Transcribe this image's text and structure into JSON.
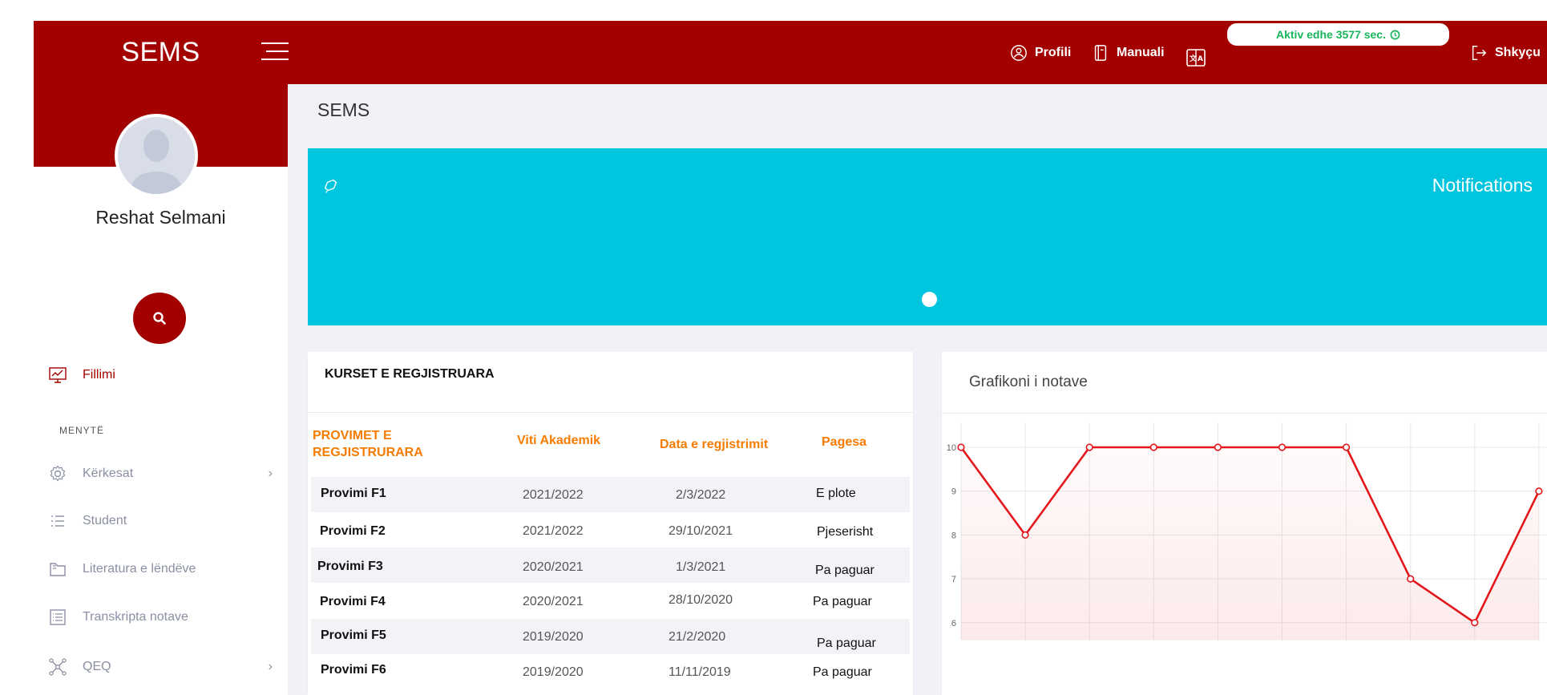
{
  "app": {
    "brand": "SEMS"
  },
  "topbar": {
    "profile_label": "Profili",
    "manual_label": "Manuali",
    "timer_text": "Aktiv edhe 3577 sec.",
    "logout_label": "Shkyçu",
    "colors": {
      "bar": "#a30000",
      "timer_text": "#17b65a"
    }
  },
  "sidebar": {
    "username": "Reshat Selmani",
    "home_label": "Fillimi",
    "section_label": "MENYTË",
    "items": [
      {
        "label": "Kërkesat",
        "icon": "gear-icon",
        "has_submenu": true
      },
      {
        "label": "Student",
        "icon": "list-icon",
        "has_submenu": false
      },
      {
        "label": "Literatura e lëndëve",
        "icon": "book-icon",
        "has_submenu": false
      },
      {
        "label": "Transkripta notave",
        "icon": "document-list-icon",
        "has_submenu": false
      },
      {
        "label": "QEQ",
        "icon": "network-icon",
        "has_submenu": true
      }
    ]
  },
  "main": {
    "page_title": "SEMS",
    "notifications": {
      "title": "Notifications",
      "color": "#00c5df"
    },
    "courses": {
      "title": "KURSET E REGJISTRUARA",
      "headers": {
        "exam_line1": "PROVIMET E",
        "exam_line2": "REGJISTRURARA",
        "year": "Viti Akademik",
        "date": "Data e regjistrimit",
        "payment": "Pagesa"
      },
      "rows": [
        {
          "exam": "Provimi F1",
          "year": "2021/2022",
          "date": "2/3/2022",
          "payment": "E plote"
        },
        {
          "exam": "Provimi F2",
          "year": "2021/2022",
          "date": "29/10/2021",
          "payment": "Pjeserisht"
        },
        {
          "exam": "Provimi F3",
          "year": "2020/2021",
          "date": "1/3/2021",
          "payment": "Pa paguar"
        },
        {
          "exam": "Provimi F4",
          "year": "2020/2021",
          "date": "28/10/2020",
          "payment": "Pa paguar"
        },
        {
          "exam": "Provimi F5",
          "year": "2019/2020",
          "date": "21/2/2020",
          "payment": "Pa paguar"
        },
        {
          "exam": "Provimi F6",
          "year": "2019/2020",
          "date": "11/11/2019",
          "payment": "Pa paguar"
        }
      ]
    },
    "grades_chart": {
      "title": "Grafikoni i notave"
    }
  },
  "chart_data": {
    "type": "line",
    "title": "Grafikoni i notave",
    "xlabel": "",
    "ylabel": "",
    "x": [
      1,
      2,
      3,
      4,
      5,
      6,
      7,
      8,
      9,
      10
    ],
    "values": [
      10,
      8,
      10,
      10,
      10,
      10,
      10,
      7,
      6,
      9
    ],
    "y_ticks": [
      10,
      9,
      8,
      7,
      6
    ],
    "visible_ylim": [
      5.6,
      10
    ],
    "grid": true,
    "line_color": "#e3171b"
  }
}
